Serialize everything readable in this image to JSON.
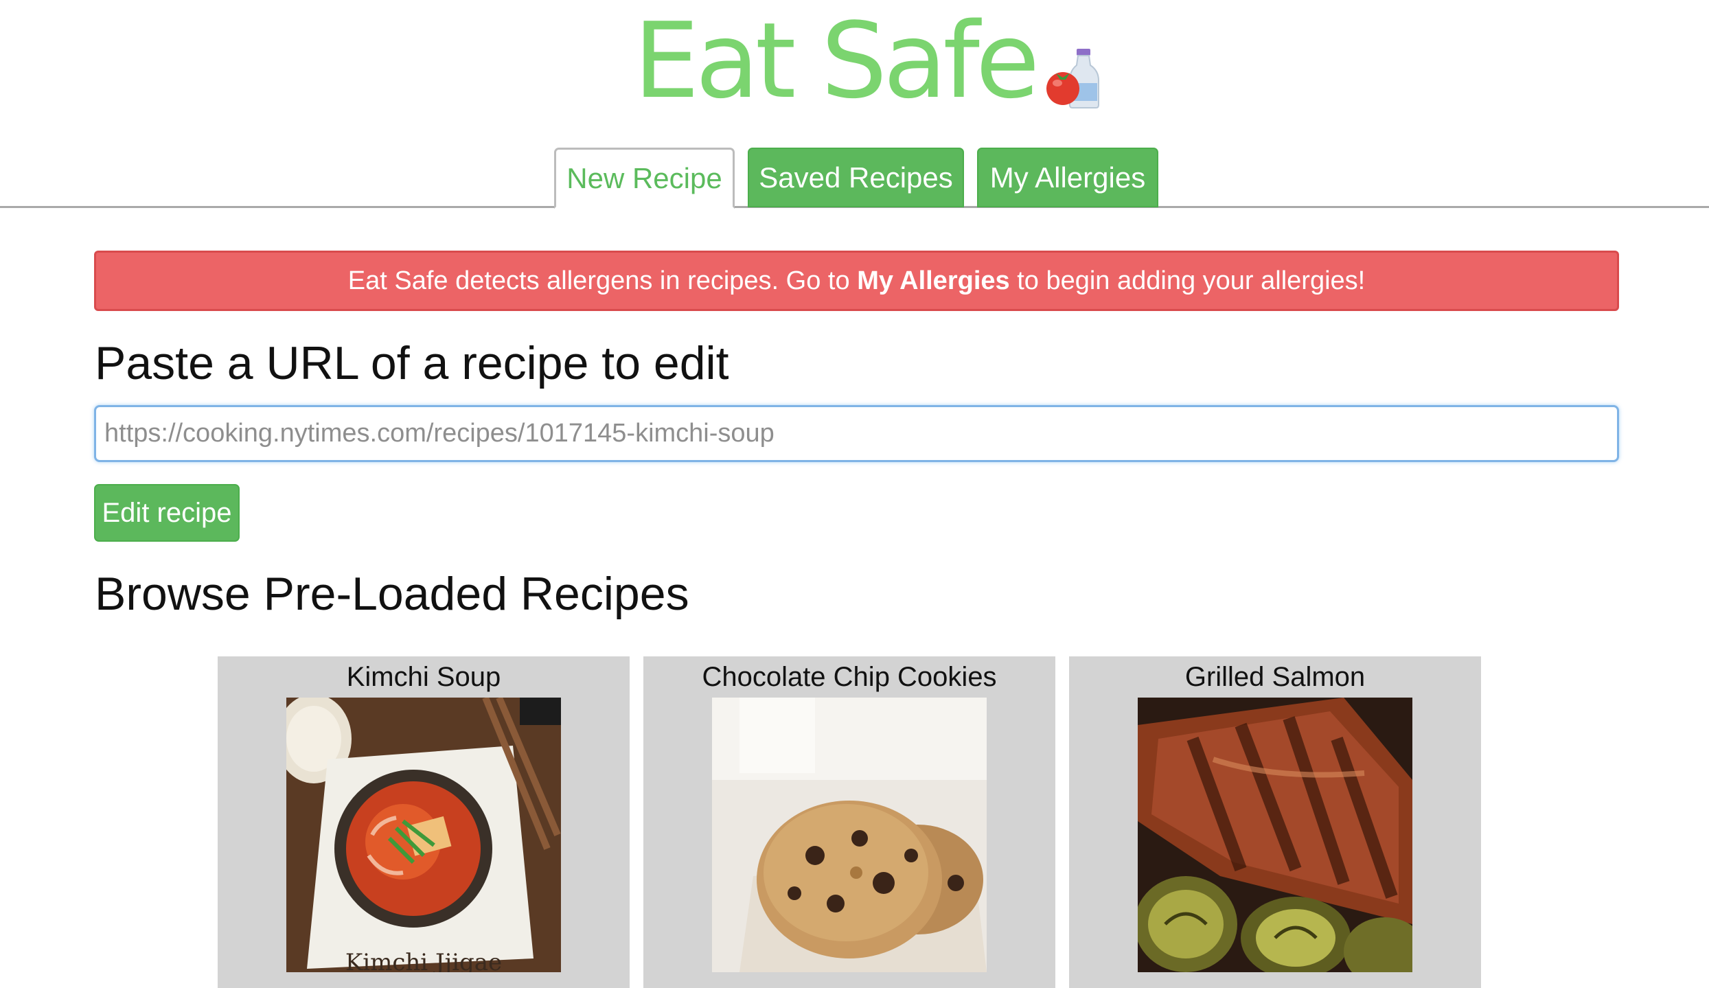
{
  "app": {
    "title": "Eat Safe",
    "logo_icon": "tomato-ketchup-bottle-icon",
    "brand_color": "#7bd46f"
  },
  "tabs": [
    {
      "label": "New Recipe",
      "active": true
    },
    {
      "label": "Saved Recipes",
      "active": false
    },
    {
      "label": "My Allergies",
      "active": false
    }
  ],
  "alert": {
    "text_before": "Eat Safe detects allergens in recipes. Go to ",
    "link_text": "My Allergies",
    "text_after": " to begin adding your allergies!",
    "color": "#ec6466"
  },
  "url_section": {
    "heading": "Paste a URL of a recipe to edit",
    "input_placeholder": "https://cooking.nytimes.com/recipes/1017145-kimchi-soup",
    "input_value": "",
    "button_label": "Edit recipe"
  },
  "browse_section": {
    "heading": "Browse Pre-Loaded Recipes",
    "recipes": [
      {
        "title": "Kimchi Soup",
        "image": "kimchi-soup-photo",
        "image_caption": "Kimchi Jjigae"
      },
      {
        "title": "Chocolate Chip Cookies",
        "image": "chocolate-chip-cookies-photo"
      },
      {
        "title": "Grilled Salmon",
        "image": "grilled-salmon-photo"
      }
    ]
  },
  "colors": {
    "button_green": "#5cb85c",
    "card_background": "#d3d3d3"
  }
}
